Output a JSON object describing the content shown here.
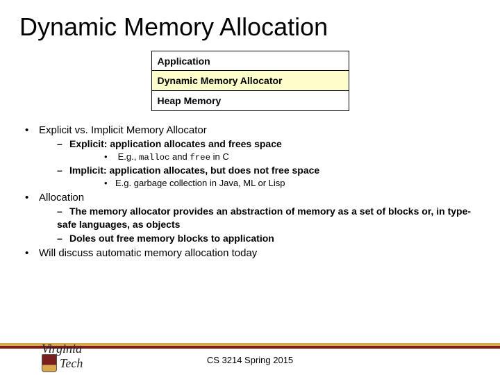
{
  "title": "Dynamic Memory Allocation",
  "stack": {
    "row1": "Application",
    "row2": "Dynamic Memory Allocator",
    "row3": "Heap Memory"
  },
  "bullets": {
    "b1_1": "Explicit vs. Implicit Memory Allocator",
    "b2_1": "Explicit:  application allocates and frees space",
    "b3_1_pre": "E.g., ",
    "b3_1_code1": "malloc",
    "b3_1_mid": " and ",
    "b3_1_code2": "free",
    "b3_1_post": " in C",
    "b2_2": "Implicit: application allocates, but does not free space",
    "b3_2": "E.g. garbage collection in Java, ML or Lisp",
    "b1_2": "Allocation",
    "b2_3": "The memory allocator provides an abstraction of memory as a set of blocks or, in type-safe languages, as objects",
    "b2_4": "Doles out free memory blocks to application",
    "b1_3": "Will discuss automatic memory allocation today"
  },
  "footer": "CS 3214 Spring 2015",
  "logo": {
    "line1": "Virginia",
    "line2": "Tech"
  }
}
